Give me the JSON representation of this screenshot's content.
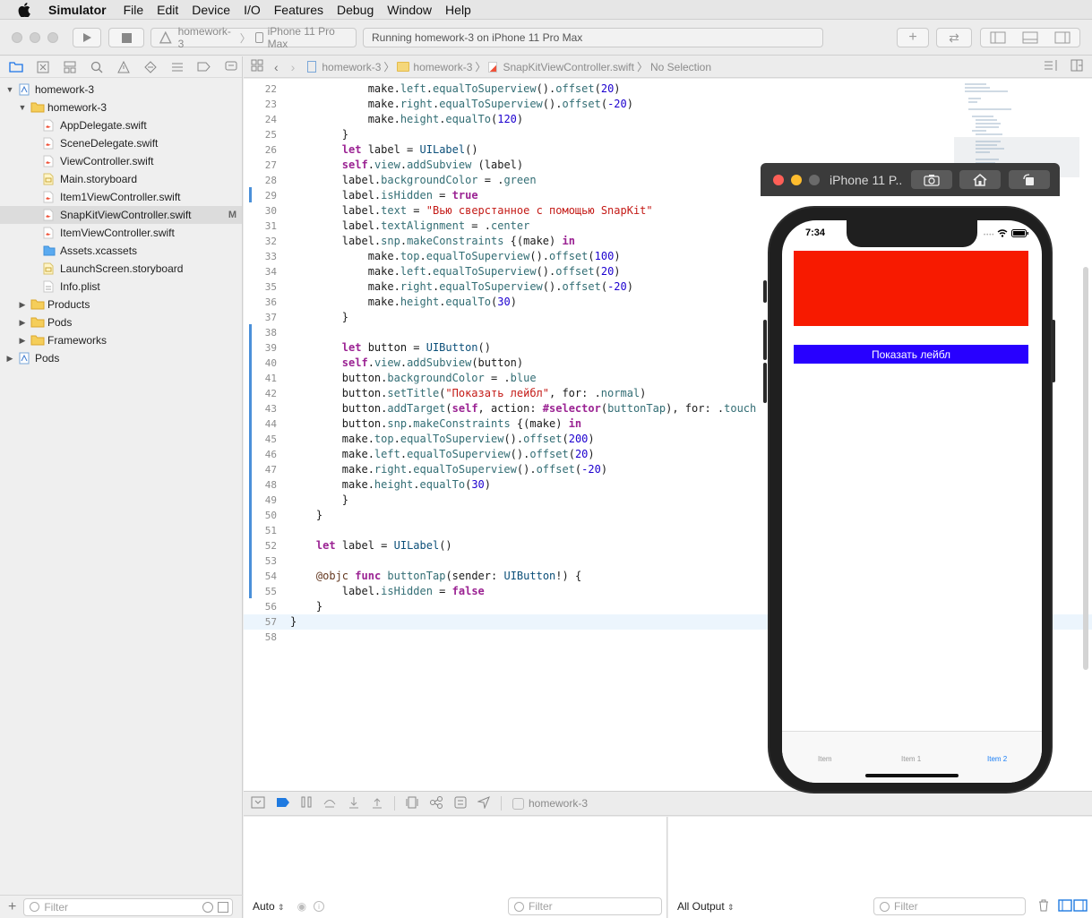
{
  "menubar": {
    "app": "Simulator",
    "items": [
      "File",
      "Edit",
      "Device",
      "I/O",
      "Features",
      "Debug",
      "Window",
      "Help"
    ]
  },
  "toolbar": {
    "scheme": "homework-3",
    "device": "iPhone 11 Pro Max",
    "status": "Running homework-3 on iPhone 11 Pro Max"
  },
  "jumpbar": {
    "crumbs": [
      "homework-3",
      "homework-3",
      "SnapKitViewController.swift",
      "No Selection"
    ]
  },
  "navigator": {
    "rows": [
      {
        "label": "homework-3",
        "level": 0,
        "kind": "project",
        "tri": "▼"
      },
      {
        "label": "homework-3",
        "level": 1,
        "kind": "folder",
        "tri": "▼"
      },
      {
        "label": "AppDelegate.swift",
        "level": 2,
        "kind": "swift",
        "tri": ""
      },
      {
        "label": "SceneDelegate.swift",
        "level": 2,
        "kind": "swift",
        "tri": ""
      },
      {
        "label": "ViewController.swift",
        "level": 2,
        "kind": "swift",
        "tri": ""
      },
      {
        "label": "Main.storyboard",
        "level": 2,
        "kind": "storyboard",
        "tri": ""
      },
      {
        "label": "Item1ViewController.swift",
        "level": 2,
        "kind": "swift",
        "tri": ""
      },
      {
        "label": "SnapKitViewController.swift",
        "level": 2,
        "kind": "swift",
        "tri": "",
        "selected": true,
        "badge": "M"
      },
      {
        "label": "ItemViewController.swift",
        "level": 2,
        "kind": "swift",
        "tri": ""
      },
      {
        "label": "Assets.xcassets",
        "level": 2,
        "kind": "assets",
        "tri": ""
      },
      {
        "label": "LaunchScreen.storyboard",
        "level": 2,
        "kind": "storyboard",
        "tri": ""
      },
      {
        "label": "Info.plist",
        "level": 2,
        "kind": "plist",
        "tri": ""
      },
      {
        "label": "Products",
        "level": 1,
        "kind": "folder",
        "tri": "▶"
      },
      {
        "label": "Pods",
        "level": 1,
        "kind": "folder",
        "tri": "▶"
      },
      {
        "label": "Frameworks",
        "level": 1,
        "kind": "folder",
        "tri": "▶"
      },
      {
        "label": "Pods",
        "level": 0,
        "kind": "project",
        "tri": "▶"
      }
    ],
    "filter_placeholder": "Filter"
  },
  "code": {
    "current_line": 57,
    "lines": [
      {
        "n": 22,
        "t": [
          [
            "            make.",
            ""
          ],
          [
            "left",
            "fn"
          ],
          [
            ".",
            ""
          ],
          [
            "equalToSuperview",
            "fn"
          ],
          [
            "().",
            ""
          ],
          [
            "offset",
            "fn"
          ],
          [
            "(",
            ""
          ],
          [
            "20",
            "nu"
          ],
          [
            ")",
            ""
          ]
        ]
      },
      {
        "n": 23,
        "t": [
          [
            "            make.",
            ""
          ],
          [
            "right",
            "fn"
          ],
          [
            ".",
            ""
          ],
          [
            "equalToSuperview",
            "fn"
          ],
          [
            "().",
            ""
          ],
          [
            "offset",
            "fn"
          ],
          [
            "(",
            ""
          ],
          [
            "-20",
            "nu"
          ],
          [
            ")",
            ""
          ]
        ]
      },
      {
        "n": 24,
        "t": [
          [
            "            make.",
            ""
          ],
          [
            "height",
            "fn"
          ],
          [
            ".",
            ""
          ],
          [
            "equalTo",
            "fn"
          ],
          [
            "(",
            ""
          ],
          [
            "120",
            "nu"
          ],
          [
            ")",
            ""
          ]
        ]
      },
      {
        "n": 25,
        "t": [
          [
            "        }",
            ""
          ]
        ]
      },
      {
        "n": 26,
        "t": [
          [
            "        ",
            ""
          ],
          [
            "let",
            "kw"
          ],
          [
            " label = ",
            ""
          ],
          [
            "UILabel",
            "ty"
          ],
          [
            "()",
            ""
          ]
        ]
      },
      {
        "n": 27,
        "t": [
          [
            "        ",
            ""
          ],
          [
            "self",
            "kw"
          ],
          [
            ".",
            ""
          ],
          [
            "view",
            "fn"
          ],
          [
            ".",
            ""
          ],
          [
            "addSubview",
            "fn"
          ],
          [
            " (label)",
            ""
          ]
        ]
      },
      {
        "n": 28,
        "t": [
          [
            "        label.",
            ""
          ],
          [
            "backgroundColor",
            "fn"
          ],
          [
            " = .",
            ""
          ],
          [
            "green",
            "fn"
          ]
        ]
      },
      {
        "n": 29,
        "t": [
          [
            "        label.",
            ""
          ],
          [
            "isHidden",
            "fn"
          ],
          [
            " = ",
            ""
          ],
          [
            "true",
            "kw"
          ]
        ]
      },
      {
        "n": 30,
        "t": [
          [
            "        label.",
            ""
          ],
          [
            "text",
            "fn"
          ],
          [
            " = ",
            ""
          ],
          [
            "\"Вью сверстанное с помощью SnapKit\"",
            "st"
          ]
        ]
      },
      {
        "n": 31,
        "t": [
          [
            "        label.",
            ""
          ],
          [
            "textAlignment",
            "fn"
          ],
          [
            " = .",
            ""
          ],
          [
            "center",
            "fn"
          ]
        ]
      },
      {
        "n": 32,
        "t": [
          [
            "        label.",
            ""
          ],
          [
            "snp",
            "fn"
          ],
          [
            ".",
            ""
          ],
          [
            "makeConstraints",
            "fn"
          ],
          [
            " {(make) ",
            ""
          ],
          [
            "in",
            "kw"
          ]
        ]
      },
      {
        "n": 33,
        "t": [
          [
            "            make.",
            ""
          ],
          [
            "top",
            "fn"
          ],
          [
            ".",
            ""
          ],
          [
            "equalToSuperview",
            "fn"
          ],
          [
            "().",
            ""
          ],
          [
            "offset",
            "fn"
          ],
          [
            "(",
            ""
          ],
          [
            "100",
            "nu"
          ],
          [
            ")",
            ""
          ]
        ]
      },
      {
        "n": 34,
        "t": [
          [
            "            make.",
            ""
          ],
          [
            "left",
            "fn"
          ],
          [
            ".",
            ""
          ],
          [
            "equalToSuperview",
            "fn"
          ],
          [
            "().",
            ""
          ],
          [
            "offset",
            "fn"
          ],
          [
            "(",
            ""
          ],
          [
            "20",
            "nu"
          ],
          [
            ")",
            ""
          ]
        ]
      },
      {
        "n": 35,
        "t": [
          [
            "            make.",
            ""
          ],
          [
            "right",
            "fn"
          ],
          [
            ".",
            ""
          ],
          [
            "equalToSuperview",
            "fn"
          ],
          [
            "().",
            ""
          ],
          [
            "offset",
            "fn"
          ],
          [
            "(",
            ""
          ],
          [
            "-20",
            "nu"
          ],
          [
            ")",
            ""
          ]
        ]
      },
      {
        "n": 36,
        "t": [
          [
            "            make.",
            ""
          ],
          [
            "height",
            "fn"
          ],
          [
            ".",
            ""
          ],
          [
            "equalTo",
            "fn"
          ],
          [
            "(",
            ""
          ],
          [
            "30",
            "nu"
          ],
          [
            ")",
            ""
          ]
        ]
      },
      {
        "n": 37,
        "t": [
          [
            "        }",
            ""
          ]
        ]
      },
      {
        "n": 38,
        "t": []
      },
      {
        "n": 39,
        "t": [
          [
            "        ",
            ""
          ],
          [
            "let",
            "kw"
          ],
          [
            " button = ",
            ""
          ],
          [
            "UIButton",
            "ty"
          ],
          [
            "()",
            ""
          ]
        ]
      },
      {
        "n": 40,
        "t": [
          [
            "        ",
            ""
          ],
          [
            "self",
            "kw"
          ],
          [
            ".",
            ""
          ],
          [
            "view",
            "fn"
          ],
          [
            ".",
            ""
          ],
          [
            "addSubview",
            "fn"
          ],
          [
            "(button)",
            ""
          ]
        ]
      },
      {
        "n": 41,
        "t": [
          [
            "        button.",
            ""
          ],
          [
            "backgroundColor",
            "fn"
          ],
          [
            " = .",
            ""
          ],
          [
            "blue",
            "fn"
          ]
        ]
      },
      {
        "n": 42,
        "t": [
          [
            "        button.",
            ""
          ],
          [
            "setTitle",
            "fn"
          ],
          [
            "(",
            ""
          ],
          [
            "\"Показать лейбл\"",
            "st"
          ],
          [
            ", for: .",
            ""
          ],
          [
            "normal",
            "fn"
          ],
          [
            ")",
            ""
          ]
        ]
      },
      {
        "n": 43,
        "t": [
          [
            "        button.",
            ""
          ],
          [
            "addTarget",
            "fn"
          ],
          [
            "(",
            ""
          ],
          [
            "self",
            "kw"
          ],
          [
            ", action: ",
            ""
          ],
          [
            "#selector",
            "kw"
          ],
          [
            "(",
            ""
          ],
          [
            "buttonTap",
            "fn"
          ],
          [
            "), for: .",
            ""
          ],
          [
            "touch",
            "fn"
          ]
        ]
      },
      {
        "n": 44,
        "t": [
          [
            "        button.",
            ""
          ],
          [
            "snp",
            "fn"
          ],
          [
            ".",
            ""
          ],
          [
            "makeConstraints",
            "fn"
          ],
          [
            " {(make) ",
            ""
          ],
          [
            "in",
            "kw"
          ]
        ]
      },
      {
        "n": 45,
        "t": [
          [
            "        make.",
            ""
          ],
          [
            "top",
            "fn"
          ],
          [
            ".",
            ""
          ],
          [
            "equalToSuperview",
            "fn"
          ],
          [
            "().",
            ""
          ],
          [
            "offset",
            "fn"
          ],
          [
            "(",
            ""
          ],
          [
            "200",
            "nu"
          ],
          [
            ")",
            ""
          ]
        ]
      },
      {
        "n": 46,
        "t": [
          [
            "        make.",
            ""
          ],
          [
            "left",
            "fn"
          ],
          [
            ".",
            ""
          ],
          [
            "equalToSuperview",
            "fn"
          ],
          [
            "().",
            ""
          ],
          [
            "offset",
            "fn"
          ],
          [
            "(",
            ""
          ],
          [
            "20",
            "nu"
          ],
          [
            ")",
            ""
          ]
        ]
      },
      {
        "n": 47,
        "t": [
          [
            "        make.",
            ""
          ],
          [
            "right",
            "fn"
          ],
          [
            ".",
            ""
          ],
          [
            "equalToSuperview",
            "fn"
          ],
          [
            "().",
            ""
          ],
          [
            "offset",
            "fn"
          ],
          [
            "(",
            ""
          ],
          [
            "-20",
            "nu"
          ],
          [
            ")",
            ""
          ]
        ]
      },
      {
        "n": 48,
        "t": [
          [
            "        make.",
            ""
          ],
          [
            "height",
            "fn"
          ],
          [
            ".",
            ""
          ],
          [
            "equalTo",
            "fn"
          ],
          [
            "(",
            ""
          ],
          [
            "30",
            "nu"
          ],
          [
            ")",
            ""
          ]
        ]
      },
      {
        "n": 49,
        "t": [
          [
            "        }",
            ""
          ]
        ]
      },
      {
        "n": 50,
        "t": [
          [
            "    }",
            ""
          ]
        ]
      },
      {
        "n": 51,
        "t": []
      },
      {
        "n": 52,
        "t": [
          [
            "    ",
            ""
          ],
          [
            "let",
            "kw"
          ],
          [
            " label = ",
            ""
          ],
          [
            "UILabel",
            "ty"
          ],
          [
            "()",
            ""
          ]
        ]
      },
      {
        "n": 53,
        "t": []
      },
      {
        "n": 54,
        "t": [
          [
            "    ",
            ""
          ],
          [
            "@objc",
            "at"
          ],
          [
            " ",
            ""
          ],
          [
            "func",
            "kw"
          ],
          [
            " ",
            ""
          ],
          [
            "buttonTap",
            "fn"
          ],
          [
            "(sender: ",
            ""
          ],
          [
            "UIButton",
            "ty"
          ],
          [
            "!) {",
            ""
          ]
        ]
      },
      {
        "n": 55,
        "t": [
          [
            "        label.",
            ""
          ],
          [
            "isHidden",
            "fn"
          ],
          [
            " = ",
            ""
          ],
          [
            "false",
            "kw"
          ]
        ]
      },
      {
        "n": 56,
        "t": [
          [
            "    }",
            ""
          ]
        ]
      },
      {
        "n": 57,
        "t": [
          [
            "}",
            ""
          ]
        ]
      },
      {
        "n": 58,
        "t": []
      }
    ]
  },
  "debug": {
    "target": "homework-3",
    "vars_mode": "Auto",
    "output_mode": "All Output",
    "filter_placeholder": "Filter"
  },
  "simulator": {
    "title": "iPhone 11 P...",
    "time": "7:34",
    "button_label": "Показать лейбл",
    "red_color": "#f71a00",
    "blue_color": "#2800ff",
    "tabs": [
      "Item",
      "Item 1",
      "Item 2"
    ],
    "selected_tab": 2
  }
}
